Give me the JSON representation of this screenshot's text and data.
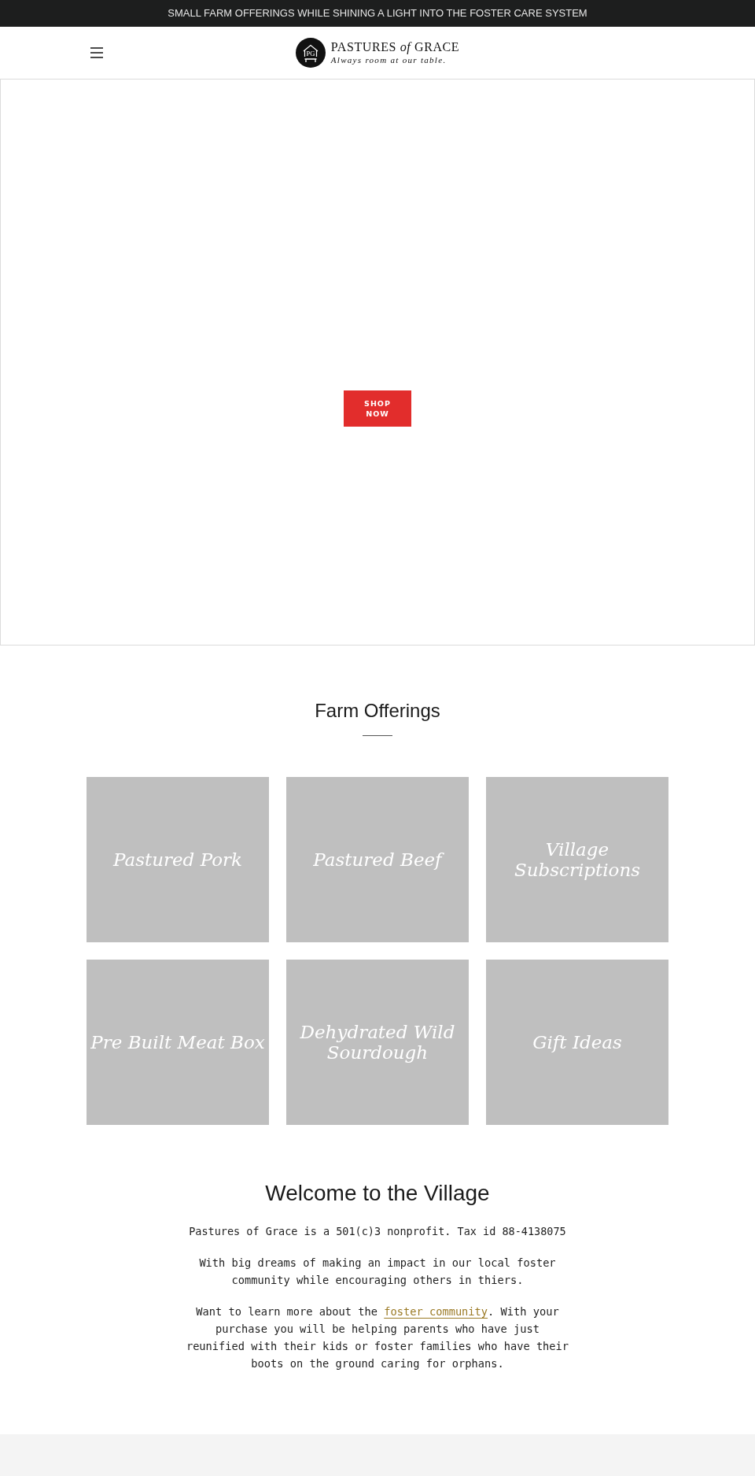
{
  "announcement": {
    "text": "SMALL FARM OFFERINGS WHILE SHINING A LIGHT INTO THE FOSTER CARE SYSTEM"
  },
  "header": {
    "logo": {
      "monogram": "PG",
      "title": "PASTURES *of* GRACE",
      "tagline": "Always room at our table."
    }
  },
  "hero": {
    "button": "SHOP NOW"
  },
  "offerings": {
    "title": "Farm Offerings",
    "tiles": [
      {
        "label": "Pastured Pork"
      },
      {
        "label": "Pastured Beef"
      },
      {
        "label": "Village Subscriptions"
      },
      {
        "label": "Pre Built Meat Box"
      },
      {
        "label": "Dehydrated Wild Sourdough"
      },
      {
        "label": "Gift Ideas"
      }
    ]
  },
  "welcome": {
    "title": "Welcome to the Village",
    "paragraphs": [
      {
        "parts": [
          {
            "kind": "text",
            "text": "Pastures of Grace is a 501(c)3 nonprofit. Tax id 88-4138075"
          }
        ]
      },
      {
        "parts": [
          {
            "kind": "text",
            "text": "With big dreams of making an impact in our local foster community while encouraging others in thiers."
          }
        ]
      },
      {
        "parts": [
          {
            "kind": "text",
            "text": "Want to learn more about the "
          },
          {
            "kind": "link",
            "text": "foster community"
          },
          {
            "kind": "text",
            "text": ". With your purchase you will be helping parents who have just reunified with their kids or foster families who have their boots on the ground caring for orphans."
          }
        ]
      }
    ]
  }
}
